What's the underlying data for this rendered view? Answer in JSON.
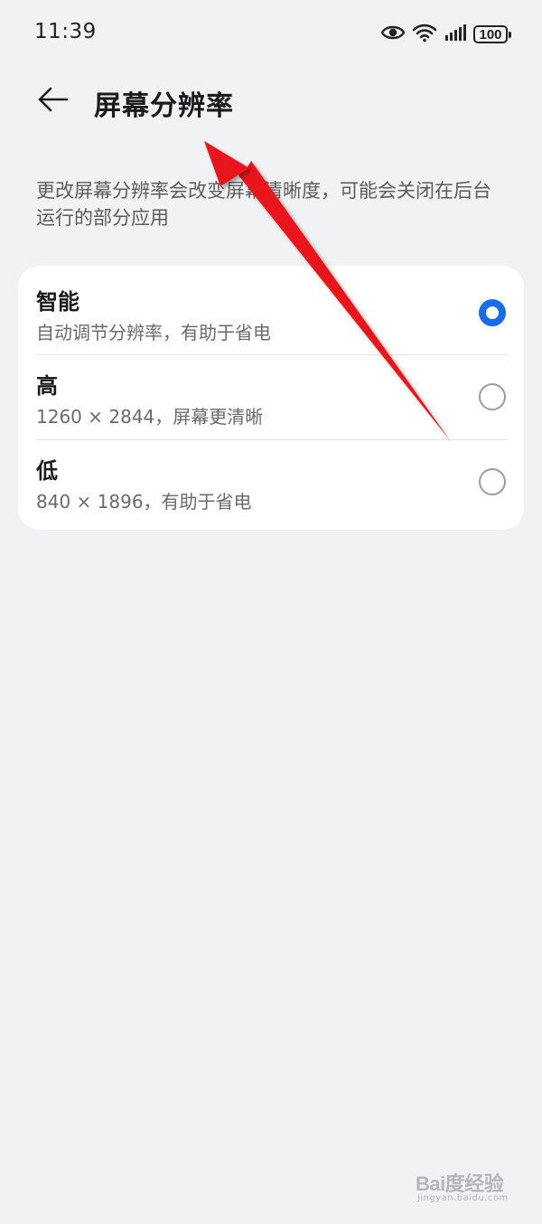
{
  "status_bar": {
    "time": "11:39",
    "battery": "100",
    "icons": [
      "eye-icon",
      "wifi-icon",
      "signal-icon",
      "battery-icon"
    ]
  },
  "header": {
    "title": "屏幕分辨率",
    "back_icon": "back-arrow-icon"
  },
  "description": "更改屏幕分辨率会改变屏幕清晰度，可能会关闭在后台运行的部分应用",
  "options": [
    {
      "title": "智能",
      "subtitle": "自动调节分辨率，有助于省电",
      "selected": true
    },
    {
      "title": "高",
      "subtitle": "1260 × 2844，屏幕更清晰",
      "selected": false
    },
    {
      "title": "低",
      "subtitle": "840 × 1896，有助于省电",
      "selected": false
    }
  ],
  "annotation": {
    "color": "#e8141c",
    "icon": "red-arrow-pointer"
  },
  "watermark": {
    "logo": "Bai度经验",
    "sub": "jingyan.baidu.com"
  },
  "colors": {
    "accent": "#1a6be6",
    "background": "#f1f2f4",
    "card": "#ffffff"
  }
}
